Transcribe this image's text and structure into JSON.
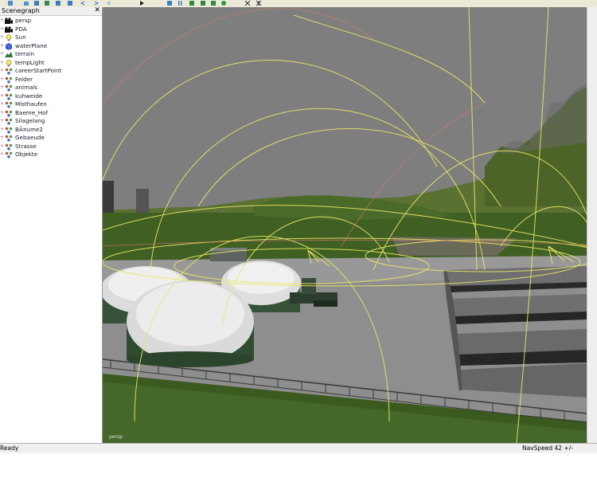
{
  "toolbar": {
    "icons": [
      "new-icon",
      "open-icon",
      "save-icon",
      "save-as-icon",
      "export-icon",
      "import-icon",
      "undo-icon",
      "redo-icon",
      "play-icon",
      "view-icon",
      "pause-icon",
      "terrain-icon",
      "object-icon",
      "paint-icon",
      "settings-icon",
      "grid-icon"
    ]
  },
  "scenegraph": {
    "title": "Scenegraph",
    "close": "✕",
    "items": [
      {
        "label": "persp",
        "icon": "camera-icon"
      },
      {
        "label": "PDA",
        "icon": "camera-icon"
      },
      {
        "label": "Sun",
        "icon": "light-bulb-icon"
      },
      {
        "label": "waterPlane",
        "icon": "cube-icon"
      },
      {
        "label": "terrain",
        "icon": "terrain-icon"
      },
      {
        "label": "tempLight",
        "icon": "light-bulb-icon"
      },
      {
        "label": "careerStartPoint",
        "icon": "transform-group-icon"
      },
      {
        "label": "Felder",
        "icon": "transform-group-icon"
      },
      {
        "label": "animals",
        "icon": "transform-group-icon"
      },
      {
        "label": "kuhweide",
        "icon": "transform-group-icon"
      },
      {
        "label": "Misthaufen",
        "icon": "transform-group-icon"
      },
      {
        "label": "Baeme_Hof",
        "icon": "transform-group-icon"
      },
      {
        "label": "Silagelang",
        "icon": "transform-group-icon"
      },
      {
        "label": "BÃ¤ume2",
        "icon": "transform-group-icon"
      },
      {
        "label": "Gebaeude",
        "icon": "transform-group-icon"
      },
      {
        "label": "Strasse",
        "icon": "transform-group-icon"
      },
      {
        "label": "Objekte",
        "icon": "transform-group-icon"
      }
    ]
  },
  "viewport": {
    "camera": "persp"
  },
  "status": {
    "left": "Ready",
    "right": "NavSpeed 42 +/-"
  },
  "colors": {
    "sky": "#7e7e7e",
    "grass": "#3e5a22",
    "hill": "#5b7132",
    "yard": "#8e8e8e",
    "gizmo": "#e9e866",
    "red_line": "#d07b6e"
  }
}
